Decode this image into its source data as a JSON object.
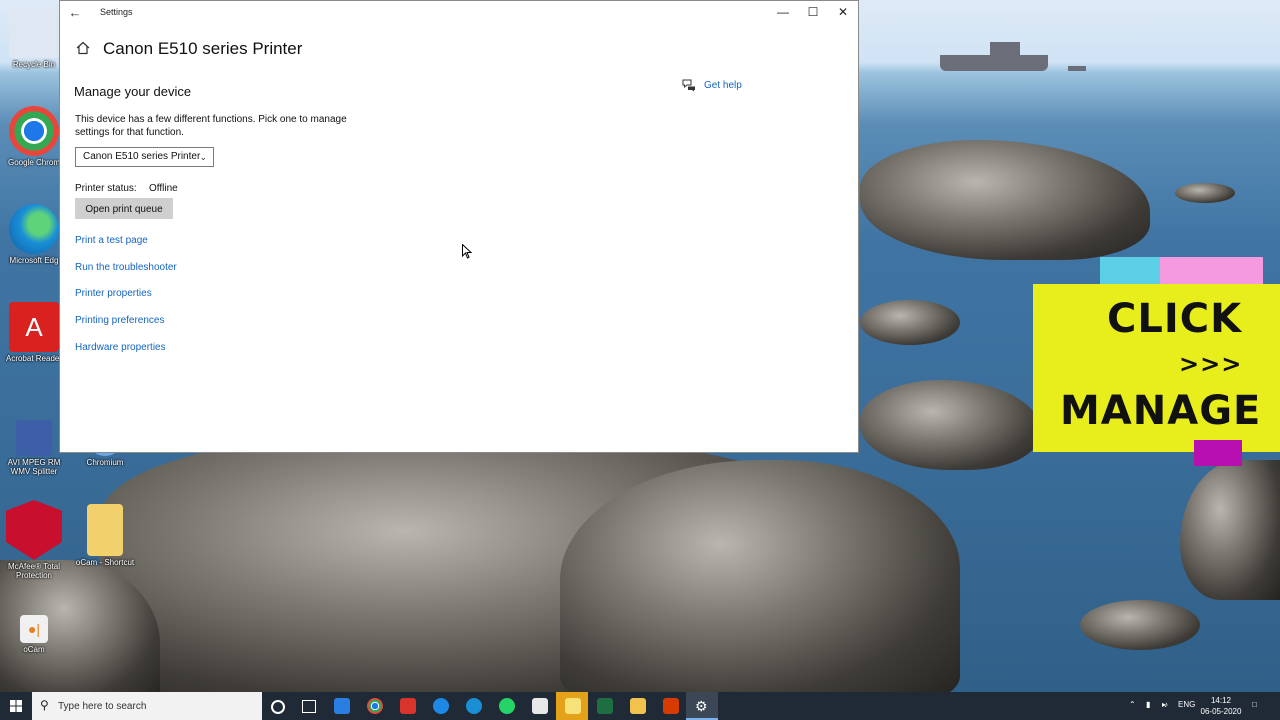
{
  "window": {
    "title": "Settings",
    "minimize_glyph": "—",
    "maximize_glyph": "☐",
    "close_glyph": "✕",
    "back_glyph": "←"
  },
  "page": {
    "title": "Canon E510 series Printer",
    "section_heading": "Manage your device",
    "description": "This device has a few different functions. Pick one to manage settings for that function.",
    "device_select": {
      "selected": "Canon E510 series Printer"
    },
    "status_label": "Printer status:",
    "status_value": "Offline",
    "open_queue_label": "Open print queue",
    "links": [
      "Print a test page",
      "Run the troubleshooter",
      "Printer properties",
      "Printing preferences",
      "Hardware properties"
    ],
    "get_help": "Get help"
  },
  "desktop_icons": [
    {
      "label": "Recycle Bin",
      "icon": "recycle-bin-icon",
      "color": "#dfe8f2"
    },
    {
      "label": "Google Chrom",
      "icon": "chrome-icon",
      "color": "#e8453c"
    },
    {
      "label": "Microsoft Edg",
      "icon": "edge-icon",
      "color": "#1a8fd6"
    },
    {
      "label": "Acrobat Reader",
      "icon": "acrobat-icon",
      "color": "#d9211f"
    },
    {
      "label": "AVI MPEG RM WMV Splitter",
      "icon": "video-splitter-icon",
      "color": "#3c5fa8"
    },
    {
      "label": "Chromium",
      "icon": "chromium-icon",
      "color": "#5a9be0"
    },
    {
      "label": "McAfee® Total Protection",
      "icon": "mcafee-icon",
      "color": "#c8102e"
    },
    {
      "label": "oCam - Shortcut",
      "icon": "folder-icon",
      "color": "#f2d06b"
    },
    {
      "label": "oCam",
      "icon": "ocam-icon",
      "color": "#f0f0f0"
    }
  ],
  "banner": {
    "line1": "CLICK",
    "line2": ">>>",
    "line3": "MANAGE"
  },
  "taskbar": {
    "search_placeholder": "Type here to search",
    "apps": [
      {
        "icon": "cortana-icon",
        "color": "#ffffff"
      },
      {
        "icon": "task-view-icon",
        "color": "#ffffff"
      },
      {
        "icon": "store-icon",
        "color": "#2a7de1"
      },
      {
        "icon": "chrome-icon",
        "color": "#e8453c"
      },
      {
        "icon": "gift-icon",
        "color": "#d9342b"
      },
      {
        "icon": "ie-icon",
        "color": "#1e88e5"
      },
      {
        "icon": "edge-icon",
        "color": "#1a8fd6"
      },
      {
        "icon": "whatsapp-icon",
        "color": "#25d366"
      },
      {
        "icon": "photos-icon",
        "color": "#e8e8e8"
      },
      {
        "icon": "sticky-notes-icon",
        "color": "#f7c948"
      },
      {
        "icon": "excel-icon",
        "color": "#1d6f42"
      },
      {
        "icon": "file-explorer-icon",
        "color": "#f2c14e"
      },
      {
        "icon": "office-icon",
        "color": "#d83b01"
      },
      {
        "icon": "settings-icon",
        "color": "#ffffff"
      }
    ],
    "language": "ENG",
    "time": "14:12",
    "date": "06-05-2020"
  },
  "colors": {
    "link": "#1565c0",
    "banner_yellow": "#e8ee1c",
    "taskbar": "#1f2a36"
  }
}
